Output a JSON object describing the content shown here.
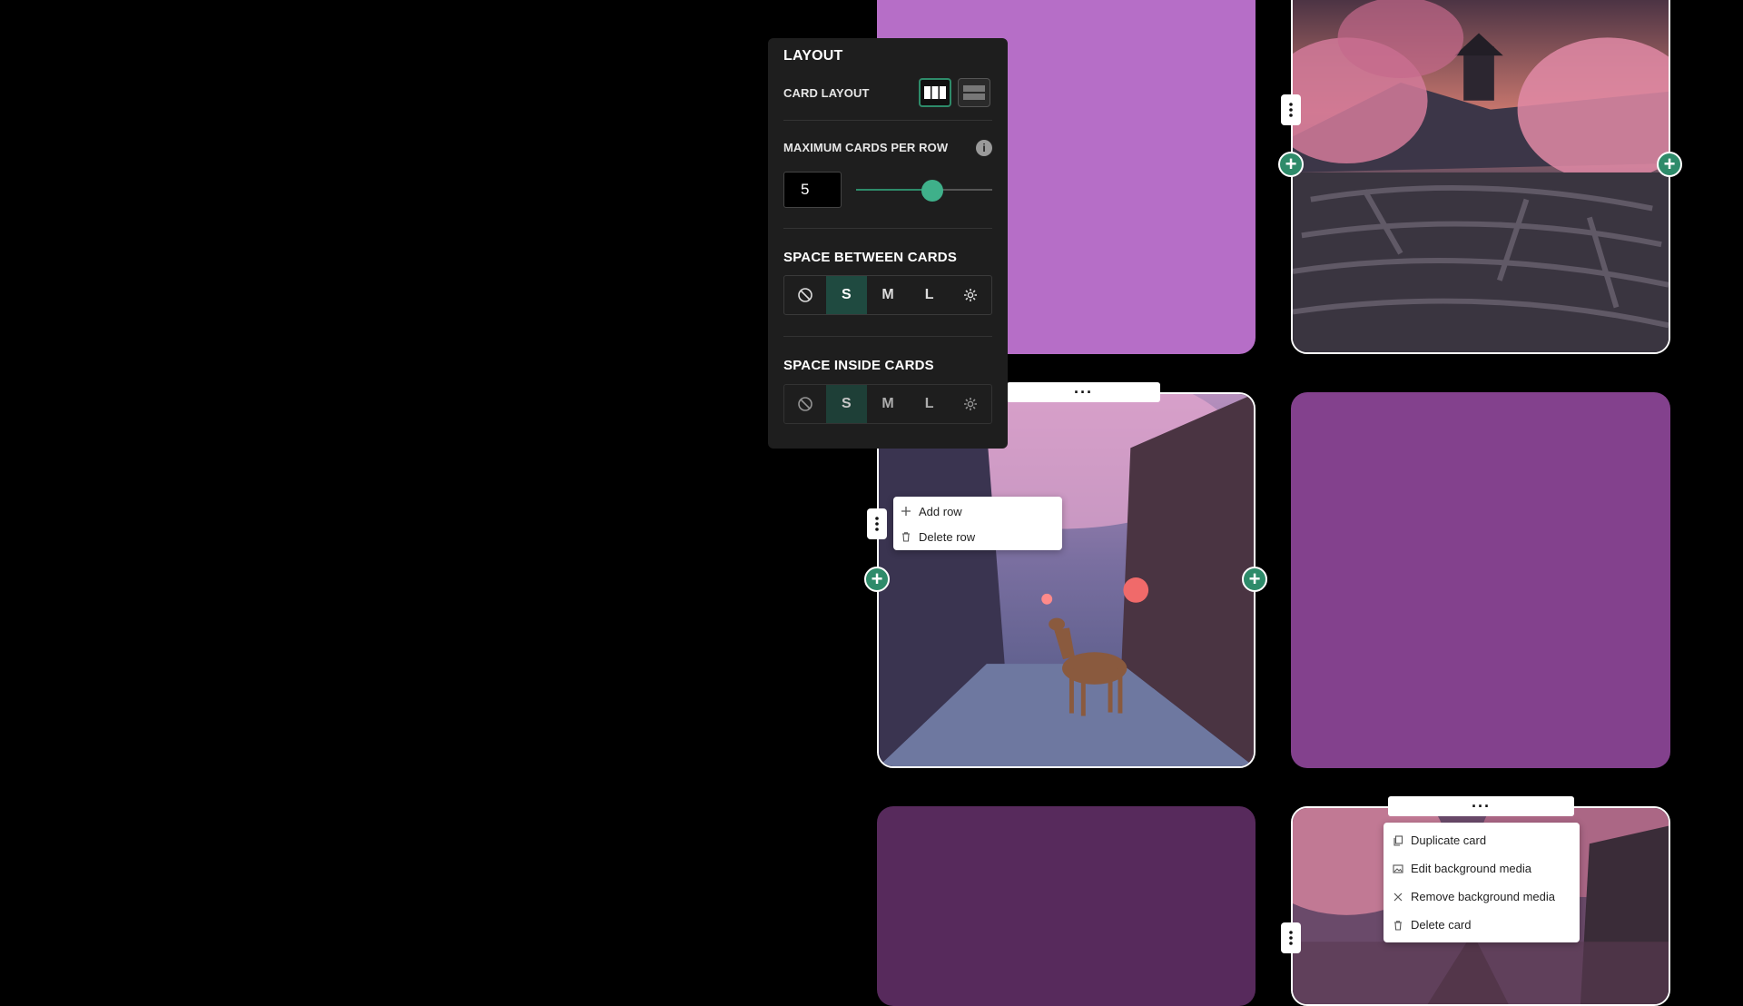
{
  "panel": {
    "heading": "LAYOUT",
    "card_layout_label": "CARD LAYOUT",
    "max_cards_label": "MAXIMUM CARDS PER ROW",
    "info_glyph": "i",
    "max_cards_value": "5",
    "slider_fraction": 0.56,
    "space_between_label": "SPACE BETWEEN CARDS",
    "space_inside_label": "SPACE INSIDE CARDS",
    "size_options": [
      "S",
      "M",
      "L"
    ],
    "selected_size_between": "S",
    "selected_size_inside": "S"
  },
  "toolbar": {
    "more_glyph": "···"
  },
  "row_menu": {
    "items": [
      {
        "label": "Add row",
        "icon": "plus-icon"
      },
      {
        "label": "Delete row",
        "icon": "trash-icon"
      }
    ]
  },
  "card_menu": {
    "items": [
      {
        "label": "Duplicate card",
        "icon": "copy-icon"
      },
      {
        "label": "Edit background media",
        "icon": "image-icon"
      },
      {
        "label": "Remove background media",
        "icon": "close-icon"
      },
      {
        "label": "Delete card",
        "icon": "trash-icon"
      }
    ]
  },
  "colors": {
    "accent": "#2e8b6a",
    "active_segment": "#1f4a40",
    "card_lavender": "#b66ec7",
    "card_purple": "#83418d",
    "card_plum": "#572a5c",
    "panel_bg": "#1e1e1e"
  }
}
